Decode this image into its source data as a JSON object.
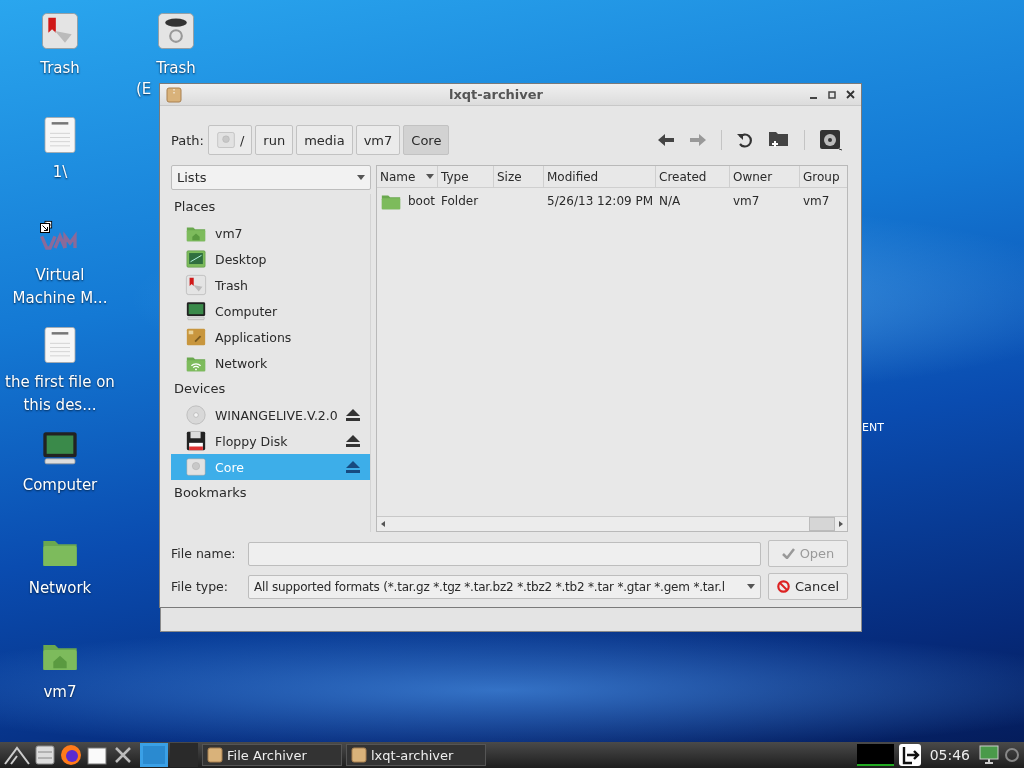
{
  "desktop": {
    "icons": [
      {
        "kind": "trash",
        "label": "Trash"
      },
      {
        "kind": "trash-bin",
        "label": "Trash",
        "label_line_2": "(E"
      },
      {
        "kind": "text-file",
        "label": "1\\"
      },
      {
        "kind": "vm",
        "label": "Virtual Machine M...",
        "shortcut": true
      },
      {
        "kind": "text-file",
        "label": "the first file on this des..."
      },
      {
        "kind": "computer",
        "label": "Computer"
      },
      {
        "kind": "folder",
        "label": "Network"
      },
      {
        "kind": "folder-home",
        "label": "vm7"
      }
    ],
    "wallpaper_text": "ENT"
  },
  "dialog": {
    "title": "lxqt-archiver",
    "path_label": "Path:",
    "path": [
      {
        "label": "/",
        "kind": "drive",
        "selected": false
      },
      {
        "label": "run",
        "kind": "plain",
        "selected": false
      },
      {
        "label": "media",
        "kind": "plain",
        "selected": false
      },
      {
        "label": "vm7",
        "kind": "plain",
        "selected": false
      },
      {
        "label": "Core",
        "kind": "plain",
        "selected": true
      }
    ],
    "view_select": "Lists",
    "sidebar": [
      {
        "heading": "Places",
        "items": [
          {
            "label": "vm7",
            "kind": "home",
            "selected": false,
            "ejectable": false
          },
          {
            "label": "Desktop",
            "kind": "desktop",
            "selected": false,
            "ejectable": false
          },
          {
            "label": "Trash",
            "kind": "trash",
            "selected": false,
            "ejectable": false
          },
          {
            "label": "Computer",
            "kind": "computer",
            "selected": false,
            "ejectable": false
          },
          {
            "label": "Applications",
            "kind": "applications",
            "selected": false,
            "ejectable": false
          },
          {
            "label": "Network",
            "kind": "network",
            "selected": false,
            "ejectable": false
          }
        ]
      },
      {
        "heading": "Devices",
        "items": [
          {
            "label": "WINANGELIVE.V.2.0",
            "kind": "optical",
            "selected": false,
            "ejectable": true
          },
          {
            "label": "Floppy Disk",
            "kind": "floppy",
            "selected": false,
            "ejectable": true
          },
          {
            "label": "Core",
            "kind": "drive",
            "selected": true,
            "ejectable": true
          }
        ]
      },
      {
        "heading": "Bookmarks"
      }
    ],
    "table": {
      "columns": [
        {
          "label": "Name",
          "sorted": true
        },
        {
          "label": "Type",
          "sorted": false
        },
        {
          "label": "Size",
          "sorted": false
        },
        {
          "label": "Modified",
          "sorted": false
        },
        {
          "label": "Created",
          "sorted": false
        },
        {
          "label": "Owner",
          "sorted": false
        },
        {
          "label": "Group",
          "sorted": false
        }
      ],
      "rows": [
        {
          "kind": "folder",
          "cells": [
            "boot",
            "Folder",
            null,
            "5/26/13 12:09 PM",
            "N/A",
            "vm7",
            "vm7"
          ]
        }
      ]
    },
    "file_name": {
      "label": "File name:"
    },
    "file_type": {
      "label": "File type:",
      "value": "All supported formats (*.tar.gz *.tgz *.tar.bz2 *.tbz2 *.tb2 *.tar *.gtar *.gem *.tar.l"
    },
    "buttons": [
      {
        "label": "Open",
        "kind": "open",
        "disabled": true
      },
      {
        "label": "Cancel",
        "kind": "cancel",
        "disabled": false
      }
    ]
  },
  "taskbar": {
    "pager": [
      {
        "selected": true
      },
      {
        "selected": false
      }
    ],
    "tasks": [
      {
        "label": "File Archiver",
        "selected": false
      },
      {
        "label": "lxqt-archiver",
        "selected": false
      }
    ],
    "clock": "05:46"
  }
}
